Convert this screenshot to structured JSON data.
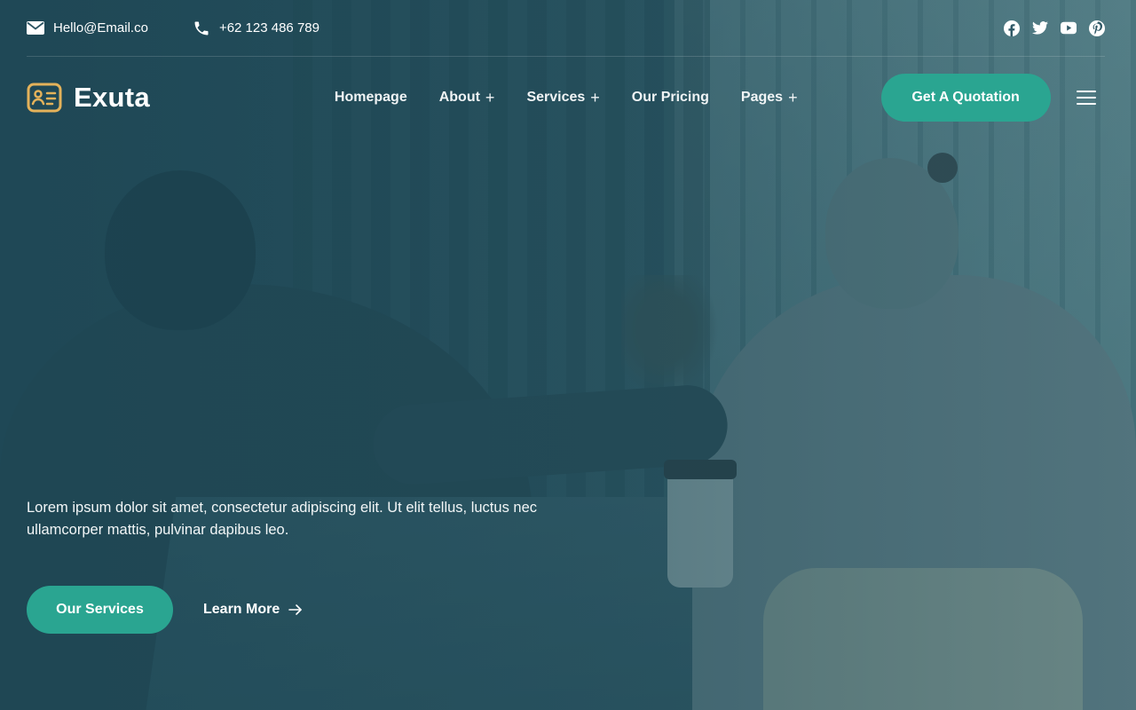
{
  "topbar": {
    "email": "Hello@Email.co",
    "phone": "+62 123 486 789",
    "socials": [
      "facebook-icon",
      "twitter-icon",
      "youtube-icon",
      "pinterest-icon"
    ]
  },
  "brand": {
    "name": "Exuta",
    "accent": "#2aa591",
    "logo_color": "#e4b25a"
  },
  "nav": {
    "items": [
      {
        "label": "Homepage",
        "has_submenu": false
      },
      {
        "label": "About",
        "has_submenu": true
      },
      {
        "label": "Services",
        "has_submenu": true
      },
      {
        "label": "Our Pricing",
        "has_submenu": false
      },
      {
        "label": "Pages",
        "has_submenu": true
      }
    ],
    "submenu_symbol": "+",
    "cta_label": "Get A Quotation"
  },
  "hero": {
    "text": "Lorem ipsum dolor sit amet, consectetur adipiscing elit. Ut elit tellus, luctus nec ullamcorper mattis, pulvinar dapibus leo.",
    "primary_label": "Our Services",
    "secondary_label": "Learn More"
  }
}
